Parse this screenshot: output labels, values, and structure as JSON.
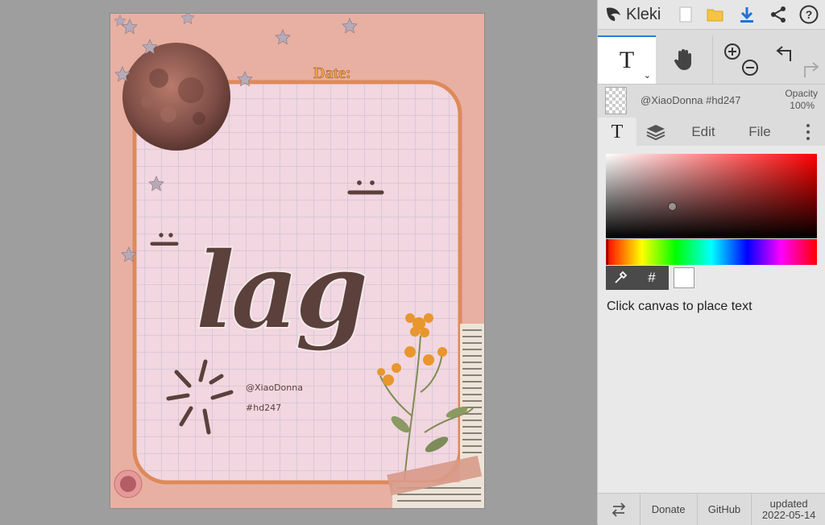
{
  "app": {
    "name": "Kleki"
  },
  "toolbar": {
    "new_icon": "new-file-icon",
    "open_icon": "folder-icon",
    "save_icon": "download-icon",
    "share_icon": "share-icon",
    "help_icon": "help-icon"
  },
  "tools": {
    "text_tool_glyph": "T",
    "hand_icon": "hand-icon",
    "zoom_in_icon": "zoom-in-icon",
    "zoom_out_icon": "zoom-out-icon",
    "undo_icon": "undo-icon",
    "redo_icon": "redo-icon"
  },
  "layer": {
    "name": "@XiaoDonna #hd247",
    "opacity_label": "Opacity",
    "opacity_value": "100%"
  },
  "tabs": {
    "text_glyph": "T",
    "edit": "Edit",
    "file": "File"
  },
  "color": {
    "hex_symbol": "#",
    "selected_hex": "#ffffff",
    "hue": "#ff0000"
  },
  "hint": "Click canvas to place text",
  "footer": {
    "donate": "Donate",
    "github": "GitHub",
    "updated_label": "updated",
    "updated_date": "2022-05-14"
  },
  "artwork": {
    "date_label": "Date:",
    "main_text": "lag",
    "credit_handle": "@XiaoDonna",
    "credit_tag": "#hd247",
    "colors": {
      "background": "#e8b0a2",
      "paper": "#f2d6e0",
      "frame": "#dd8a5a",
      "ink": "#5b403c"
    }
  }
}
